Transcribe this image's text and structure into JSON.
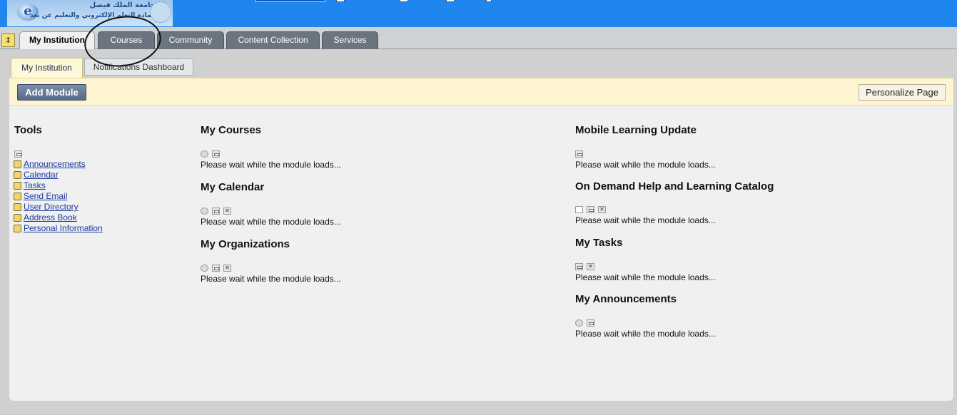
{
  "header": {
    "logo_text_line1": "جامعة الملك فيصل",
    "logo_text_line2": "عمادة التعلم الإلكتروني والتعليم عن بعد"
  },
  "main_tabs": [
    {
      "label": "My Institution",
      "active": true
    },
    {
      "label": "Courses",
      "active": false
    },
    {
      "label": "Community",
      "active": false
    },
    {
      "label": "Content Collection",
      "active": false
    },
    {
      "label": "Services",
      "active": false
    }
  ],
  "sub_tabs": [
    {
      "label": "My Institution",
      "active": true
    },
    {
      "label": "Notifications Dashboard",
      "active": false
    }
  ],
  "actions": {
    "add_module": "Add Module",
    "personalize_page": "Personalize Page"
  },
  "tools": {
    "title": "Tools",
    "items": [
      {
        "label": "Announcements",
        "icon": "megaphone-icon"
      },
      {
        "label": "Calendar",
        "icon": "calendar-icon"
      },
      {
        "label": "Tasks",
        "icon": "clipboard-icon"
      },
      {
        "label": "Send Email",
        "icon": "envelope-icon"
      },
      {
        "label": "User Directory",
        "icon": "search-user-icon"
      },
      {
        "label": "Address Book",
        "icon": "address-book-icon"
      },
      {
        "label": "Personal Information",
        "icon": "id-card-icon"
      }
    ]
  },
  "modules": [
    {
      "title": "My Courses",
      "message": "Please wait while the module loads..."
    },
    {
      "title": "My Calendar",
      "message": "Please wait while the module loads..."
    },
    {
      "title": "My Organizations",
      "message": "Please wait while the module loads..."
    },
    {
      "title": "Mobile Learning Update",
      "message": "Please wait while the module loads..."
    },
    {
      "title": "On Demand Help and Learning Catalog",
      "message": "Please wait while the module loads..."
    },
    {
      "title": "My Tasks",
      "message": "Please wait while the module loads..."
    },
    {
      "title": "My Announcements",
      "message": "Please wait while the module loads..."
    }
  ],
  "colors": {
    "header_blue": "#1f86f0",
    "tab_inactive": "#6b7580",
    "action_bar": "#fef5d0",
    "link_blue": "#1a3aa0"
  }
}
